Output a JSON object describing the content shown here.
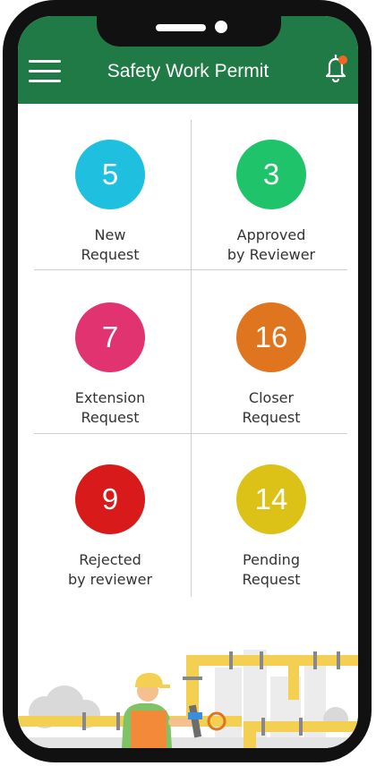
{
  "app": {
    "title": "Safety Work Permit"
  },
  "header": {
    "menu_icon": "hamburger-icon",
    "bell_icon": "bell-icon",
    "notification_dot_color": "#f26522"
  },
  "theme": {
    "primary": "#1f7a45"
  },
  "tiles": [
    {
      "count": "5",
      "line1": "New",
      "line2": "Request",
      "color": "#1fbfe0"
    },
    {
      "count": "3",
      "line1": "Approved",
      "line2": "by Reviewer",
      "color": "#1fc36a"
    },
    {
      "count": "7",
      "line1": "Extension",
      "line2": "Request",
      "color": "#e0336f"
    },
    {
      "count": "16",
      "line1": "Closer",
      "line2": "Request",
      "color": "#e0751f"
    },
    {
      "count": "9",
      "line1": "Rejected",
      "line2": "by reviewer",
      "color": "#d81a1a"
    },
    {
      "count": "14",
      "line1": "Pending",
      "line2": "Request",
      "color": "#dcc216"
    }
  ]
}
